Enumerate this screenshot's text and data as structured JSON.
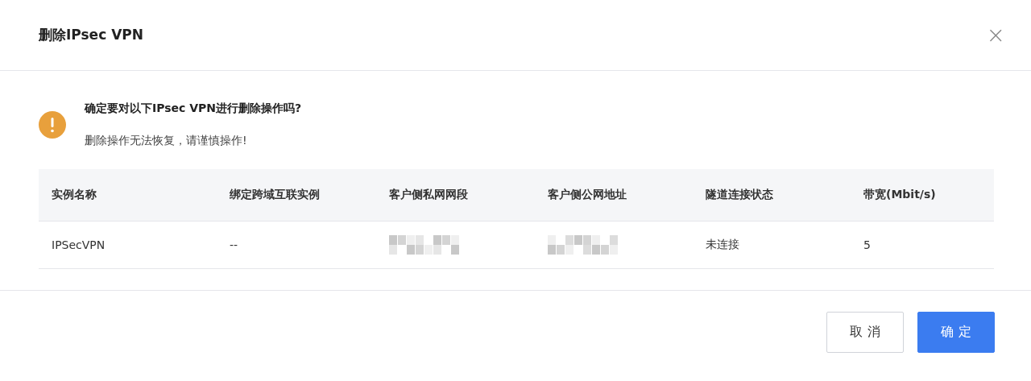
{
  "dialog": {
    "title": "删除IPsec VPN",
    "close": "×"
  },
  "warning": {
    "heading": "确定要对以下IPsec VPN进行删除操作吗?",
    "message": "删除操作无法恢复，请谨慎操作!"
  },
  "table": {
    "columns": [
      "实例名称",
      "绑定跨域互联实例",
      "客户侧私网网段",
      "客户侧公网地址",
      "隧道连接状态",
      "带宽(Mbit/s)"
    ],
    "rows": [
      [
        {
          "kind": "text",
          "text": "IPSecVPN"
        },
        {
          "kind": "text",
          "text": "--"
        },
        {
          "kind": "redacted"
        },
        {
          "kind": "redacted"
        },
        {
          "kind": "text",
          "text": "未连接"
        },
        {
          "kind": "text",
          "text": "5"
        }
      ]
    ]
  },
  "buttons": [
    {
      "label": "取 消",
      "kind": "secondary"
    },
    {
      "label": "确 定",
      "kind": "primary"
    }
  ]
}
